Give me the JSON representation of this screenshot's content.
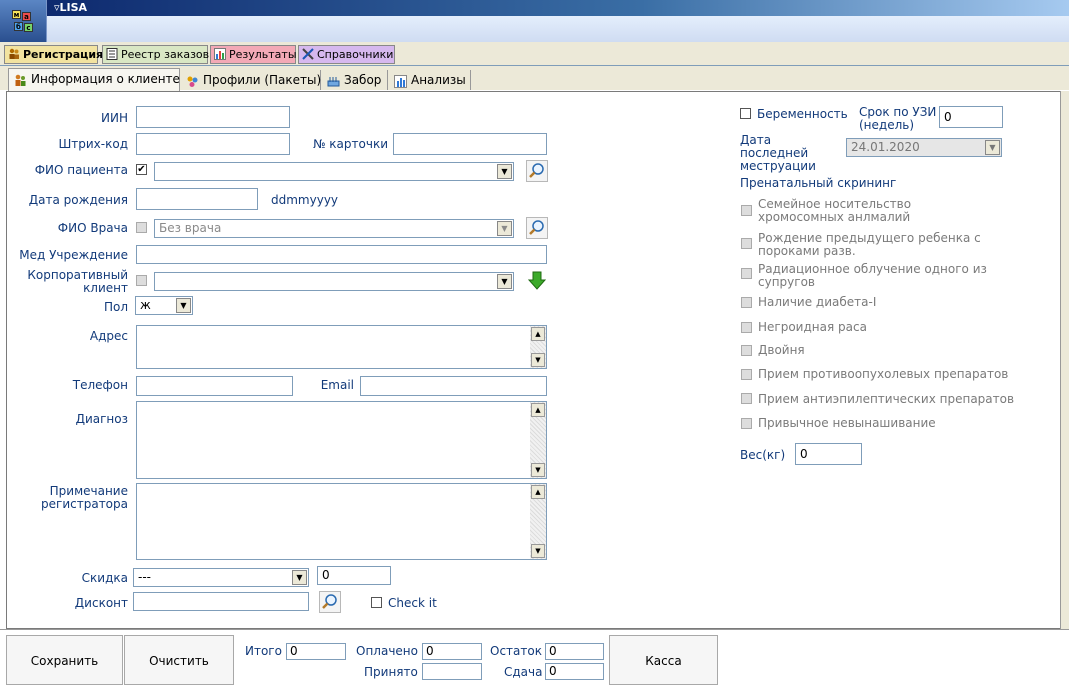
{
  "app": {
    "title": "LISA",
    "menu_marker": "▿"
  },
  "main_tabs": [
    {
      "label": "Регистрация",
      "icon": "people-icon",
      "color": "#f2e3a0"
    },
    {
      "label": "Реестр заказов",
      "icon": "register-icon",
      "color": "#d9e7c4"
    },
    {
      "label": "Результаты",
      "icon": "results-icon",
      "color": "#f3a9b6"
    },
    {
      "label": "Справочники",
      "icon": "tools-icon",
      "color": "#d6b8ee"
    }
  ],
  "sub_tabs": [
    {
      "label": "Информация о клиенте",
      "icon": "people-icon"
    },
    {
      "label": "Профили (Пакеты)",
      "icon": "profiles-icon"
    },
    {
      "label": "Забор",
      "icon": "tray-icon"
    },
    {
      "label": "Анализы",
      "icon": "analysis-icon"
    }
  ],
  "form": {
    "iin_label": "ИИН",
    "iin_value": "",
    "barcode_label": "Штрих-код",
    "barcode_value": "",
    "card_label": "№ карточки",
    "card_value": "",
    "patient_label": "ФИО пациента",
    "patient_checked": "✔",
    "patient_value": "",
    "dob_label": "Дата рождения",
    "dob_value": "",
    "dob_hint": "ddmmyyyy",
    "doctor_label": "ФИО Врача",
    "doctor_value": "Без врача",
    "med_label": "Мед Учреждение",
    "med_value": "",
    "corp_label": "Корпоративный клиент",
    "corp_value": "",
    "sex_label": "Пол",
    "sex_value": "ж",
    "address_label": "Адрес",
    "phone_label": "Телефон",
    "phone_value": "",
    "email_label": "Email",
    "email_value": "",
    "diagnosis_label": "Диагноз",
    "note_label": "Примечание регистратора",
    "discount_label": "Скидка",
    "discount_value": "---",
    "discount_amount": "0",
    "discount_card_label": "Дисконт",
    "discount_card_value": "",
    "check_label": "Check it"
  },
  "prenatal": {
    "pregnancy_label": "Беременность",
    "us_term_label": "Срок по УЗИ (недель)",
    "us_term_value": "0",
    "last_period_label": "Дата последней меструации",
    "last_period_value": "24.01.2020",
    "screening_title": "Пренатальный скрининг",
    "items": [
      "Семейное носительство хромосомных анлмалий",
      "Рождение предыдущего ребенка  с пороками разв.",
      "Радиационное облучение одного из супругов",
      "Наличие диабета-I",
      "Негроидная раса",
      "Двойня",
      "Прием противоопухолевых препаратов",
      "Прием антиэпилептических препаратов",
      "Привычное невынашивание"
    ],
    "weight_label": "Вес(кг)",
    "weight_value": "0"
  },
  "footer": {
    "save": "Сохранить",
    "clear": "Очистить",
    "cash": "Касса",
    "total_label": "Итого",
    "total_value": "0",
    "paid_label": "Оплачено",
    "paid_value": "0",
    "rest_label": "Остаток",
    "rest_value": "0",
    "received_label": "Принято",
    "received_value": "",
    "change_label": "Сдача",
    "change_value": "0"
  }
}
